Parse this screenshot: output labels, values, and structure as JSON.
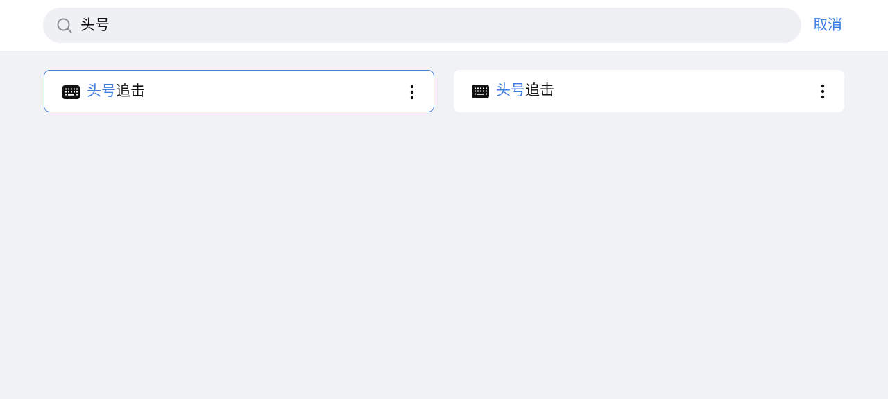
{
  "search": {
    "query": "头号",
    "cancel_label": "取消"
  },
  "results": [
    {
      "highlight": "头号",
      "rest": "追击",
      "selected": true,
      "icon": "keyboard-icon"
    },
    {
      "highlight": "头号",
      "rest": "追击",
      "selected": false,
      "icon": "keyboard-icon"
    }
  ],
  "colors": {
    "accent": "#3d7be0",
    "background": "#f1f2f6",
    "search_bg": "#eff0f4",
    "selected_border": "#4a80d6"
  }
}
